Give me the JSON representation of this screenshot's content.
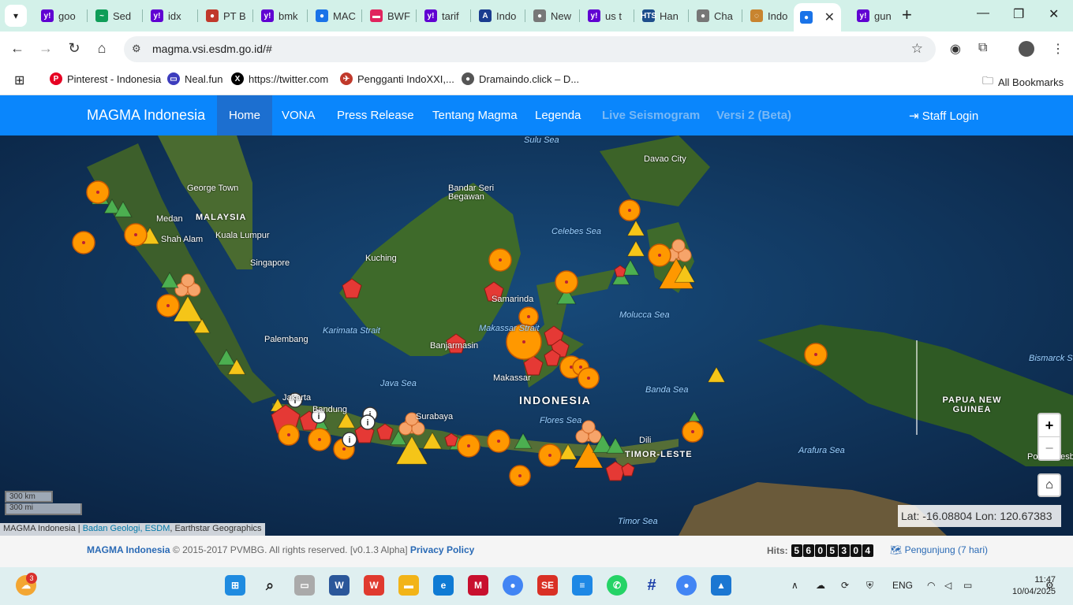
{
  "browser": {
    "tabs": [
      {
        "label": "goo",
        "color": "#6001d2",
        "glyph": "y!"
      },
      {
        "label": "Sed",
        "color": "#0f9d58",
        "glyph": "~"
      },
      {
        "label": "idx",
        "color": "#6001d2",
        "glyph": "y!"
      },
      {
        "label": "PT B",
        "color": "#c0392b",
        "glyph": "●"
      },
      {
        "label": "bmk",
        "color": "#6001d2",
        "glyph": "y!"
      },
      {
        "label": "MAC",
        "color": "#1a73e8",
        "glyph": "●"
      },
      {
        "label": "BWF",
        "color": "#e0245e",
        "glyph": "▬"
      },
      {
        "label": "tarif",
        "color": "#6001d2",
        "glyph": "y!"
      },
      {
        "label": "Indo",
        "color": "#1a3c8f",
        "glyph": "A"
      },
      {
        "label": "New",
        "color": "#777777",
        "glyph": "●"
      },
      {
        "label": "us t",
        "color": "#6001d2",
        "glyph": "y!"
      },
      {
        "label": "Han",
        "color": "#1e4e8c",
        "glyph": "HTS"
      },
      {
        "label": "Cha",
        "color": "#777777",
        "glyph": "●"
      },
      {
        "label": "Indo",
        "color": "#c8842f",
        "glyph": "◌"
      },
      {
        "label": "",
        "color": "#1a73e8",
        "glyph": "●",
        "active": true
      },
      {
        "label": "gun",
        "color": "#6001d2",
        "glyph": "y!"
      }
    ],
    "url": "magma.vsi.esdm.go.id/#",
    "bookmarks": [
      {
        "label": "Pinterest - Indonesia",
        "color": "#e60023",
        "glyph": "P"
      },
      {
        "label": "Neal.fun",
        "color": "#3d3dbd",
        "glyph": "▭"
      },
      {
        "label": "https://twitter.com",
        "color": "#000000",
        "glyph": "X"
      },
      {
        "label": "Pengganti IndoXXI,...",
        "color": "#c0392b",
        "glyph": "✈"
      },
      {
        "label": "Dramaindo.click – D...",
        "color": "#555555",
        "glyph": "●"
      }
    ],
    "all_bookmarks": "All Bookmarks"
  },
  "navbar": {
    "brand": "MAGMA Indonesia",
    "items": [
      "Home",
      "VONA",
      "Press Release",
      "Tentang Magma",
      "Legenda"
    ],
    "disabled_items": [
      "Live Seismogram",
      "Versi 2 (Beta)"
    ],
    "staff_login": "Staff Login"
  },
  "map": {
    "place_labels": [
      "Sulu Sea",
      "Davao City",
      "George Town",
      "MALAYSIA",
      "Medan",
      "Shah Alam",
      "Kuala Lumpur",
      "Singapore",
      "Bandar Seri Begawan",
      "Celebes Sea",
      "Kuching",
      "Samarinda",
      "Makassar Strait",
      "Karimata Strait",
      "Palembang",
      "Banjarmasin",
      "Molucca Sea",
      "Makassar",
      "Java Sea",
      "INDONESIA",
      "Banda Sea",
      "Flores Sea",
      "Surabaya",
      "Bandung",
      "Jakarta",
      "Dili",
      "TIMOR-LESTE",
      "Arafura Sea",
      "PAPUA NEW GUINEA",
      "Bismarck Sea",
      "Timor Sea",
      "Port Moresby"
    ],
    "scale_km": "300 km",
    "scale_mi": "300 mi",
    "attribution_prefix": "MAGMA Indonesia | ",
    "attribution_link": "Badan Geologi, ESDM",
    "attribution_suffix": ", Earthstar Geographics",
    "coords": "Lat: -16.08804 Lon: 120.67383",
    "zoom_in": "+",
    "zoom_out": "−"
  },
  "footer": {
    "brand": "MAGMA Indonesia",
    "copyright": " © 2015-2017 PVMBG. All rights reserved. [v0.1.3 Alpha] ",
    "privacy": "Privacy Policy",
    "hits_label": "Hits:",
    "hits_digits": [
      "5",
      "6",
      "0",
      "5",
      "3",
      "0",
      "4"
    ],
    "visitors": "Pengunjung (7 hari)"
  },
  "taskbar": {
    "badge": "3",
    "language": "ENG",
    "time": "11:47",
    "date": "10/04/2025"
  },
  "colors": {
    "navbar": "#0a86fc",
    "nav_active": "#1c6fd0",
    "volcano_normal": "#4caf50",
    "volcano_waspada": "#f5c518",
    "volcano_siaga": "#ff9800",
    "volcano_awas": "#e53935"
  }
}
